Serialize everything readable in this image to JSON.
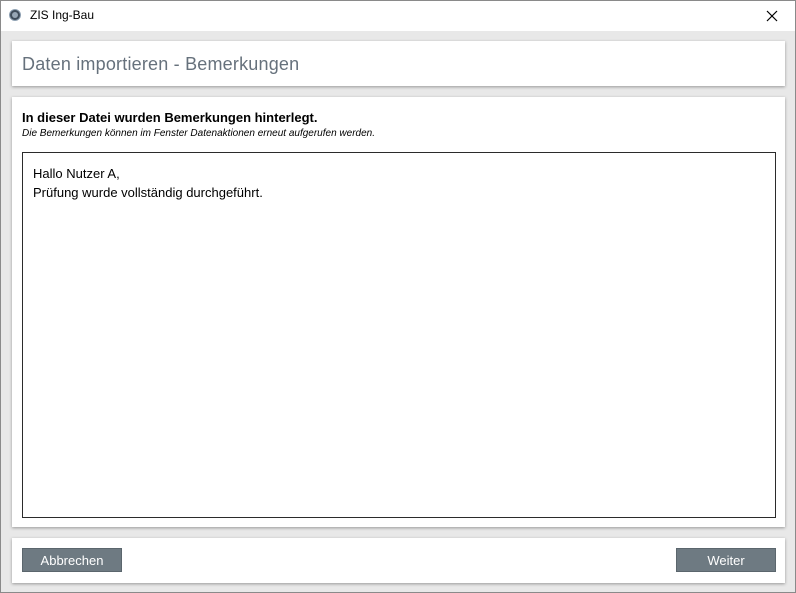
{
  "window": {
    "title": "ZIS Ing-Bau",
    "close_icon": "close-icon"
  },
  "header": {
    "title": "Daten importieren - Bemerkungen"
  },
  "content": {
    "heading": "In dieser Datei wurden Bemerkungen hinterlegt.",
    "subtext": "Die Bemerkungen können im Fenster Datenaktionen erneut aufgerufen werden.",
    "remarks": {
      "line1": "Hallo Nutzer A,",
      "line2": "Prüfung wurde vollständig durchgeführt."
    }
  },
  "footer": {
    "cancel_label": "Abbrechen",
    "next_label": "Weiter"
  },
  "colors": {
    "button_bg": "#6e7a82",
    "header_text": "#66717c",
    "window_bg": "#e8e8e8"
  }
}
